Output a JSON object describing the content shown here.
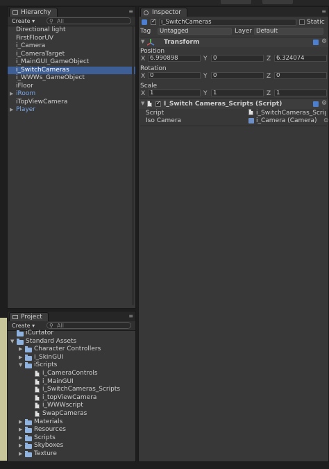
{
  "hierarchy": {
    "tab": "Hierarchy",
    "create": "Create ▾",
    "search_placeholder": "All",
    "items": [
      {
        "label": "Directional light",
        "state": "normal"
      },
      {
        "label": "FirstFloorUV",
        "state": "normal"
      },
      {
        "label": "i_Camera",
        "state": "normal"
      },
      {
        "label": "i_CameraTarget",
        "state": "normal"
      },
      {
        "label": "i_MainGUI_GameObject",
        "state": "normal"
      },
      {
        "label": "i_SwitchCameras",
        "state": "selected"
      },
      {
        "label": "i_WWWs_GameObject",
        "state": "normal"
      },
      {
        "label": "iFloor",
        "state": "normal"
      },
      {
        "label": "iRoom",
        "state": "prefab",
        "expandable": true
      },
      {
        "label": "iTopViewCamera",
        "state": "normal"
      },
      {
        "label": "Player",
        "state": "prefab",
        "expandable": true
      }
    ]
  },
  "project": {
    "tab": "Project",
    "create": "Create ▾",
    "search_placeholder": "All",
    "items": [
      {
        "label": "iCurtator",
        "depth": 0,
        "kind": "folder",
        "arrow": ""
      },
      {
        "label": "Standard Assets",
        "depth": 0,
        "kind": "folder",
        "arrow": "▼"
      },
      {
        "label": "Character Controllers",
        "depth": 1,
        "kind": "folder",
        "arrow": "▶"
      },
      {
        "label": "i_SkinGUI",
        "depth": 1,
        "kind": "folder",
        "arrow": "▶"
      },
      {
        "label": "iScripts",
        "depth": 1,
        "kind": "folder",
        "arrow": "▼"
      },
      {
        "label": "i_CameraControls",
        "depth": 2,
        "kind": "file",
        "arrow": ""
      },
      {
        "label": "i_MainGUI",
        "depth": 2,
        "kind": "file",
        "arrow": ""
      },
      {
        "label": "i_SwitchCameras_Scripts",
        "depth": 2,
        "kind": "file",
        "arrow": ""
      },
      {
        "label": "i_topViewCamera",
        "depth": 2,
        "kind": "file",
        "arrow": ""
      },
      {
        "label": "i_WWWscript",
        "depth": 2,
        "kind": "file",
        "arrow": ""
      },
      {
        "label": "SwapCameras",
        "depth": 2,
        "kind": "file",
        "arrow": ""
      },
      {
        "label": "Materials",
        "depth": 1,
        "kind": "folder",
        "arrow": "▶"
      },
      {
        "label": "Resources",
        "depth": 1,
        "kind": "folder",
        "arrow": "▶"
      },
      {
        "label": "Scripts",
        "depth": 1,
        "kind": "folder",
        "arrow": "▶"
      },
      {
        "label": "Skyboxes",
        "depth": 1,
        "kind": "folder",
        "arrow": "▶"
      },
      {
        "label": "Texture",
        "depth": 1,
        "kind": "folder",
        "arrow": "▶"
      }
    ]
  },
  "inspector": {
    "tab": "Inspector",
    "object_name": "i_SwitchCameras",
    "active": true,
    "static_label": "Static",
    "static": false,
    "tag_label": "Tag",
    "tag_value": "Untagged",
    "layer_label": "Layer",
    "layer_value": "Default",
    "transform": {
      "title": "Transform",
      "position_label": "Position",
      "rotation_label": "Rotation",
      "scale_label": "Scale",
      "axis_x": "X",
      "axis_y": "Y",
      "axis_z": "Z",
      "position": {
        "x": "6.990898",
        "y": "0",
        "z": "6.324074"
      },
      "rotation": {
        "x": "0",
        "y": "0",
        "z": "0"
      },
      "scale": {
        "x": "1",
        "y": "1",
        "z": "1"
      }
    },
    "script_component": {
      "title": "I_Switch Cameras_Scripts  (Script)",
      "enabled": true,
      "script_label": "Script",
      "script_value": "i_SwitchCameras_Scrip",
      "iso_label": "Iso Camera",
      "iso_value": "i_Camera (Camera)"
    }
  },
  "colors": {
    "selection": "#3e5f96",
    "prefab_text": "#7aa6e6",
    "panel_bg": "#383838"
  }
}
